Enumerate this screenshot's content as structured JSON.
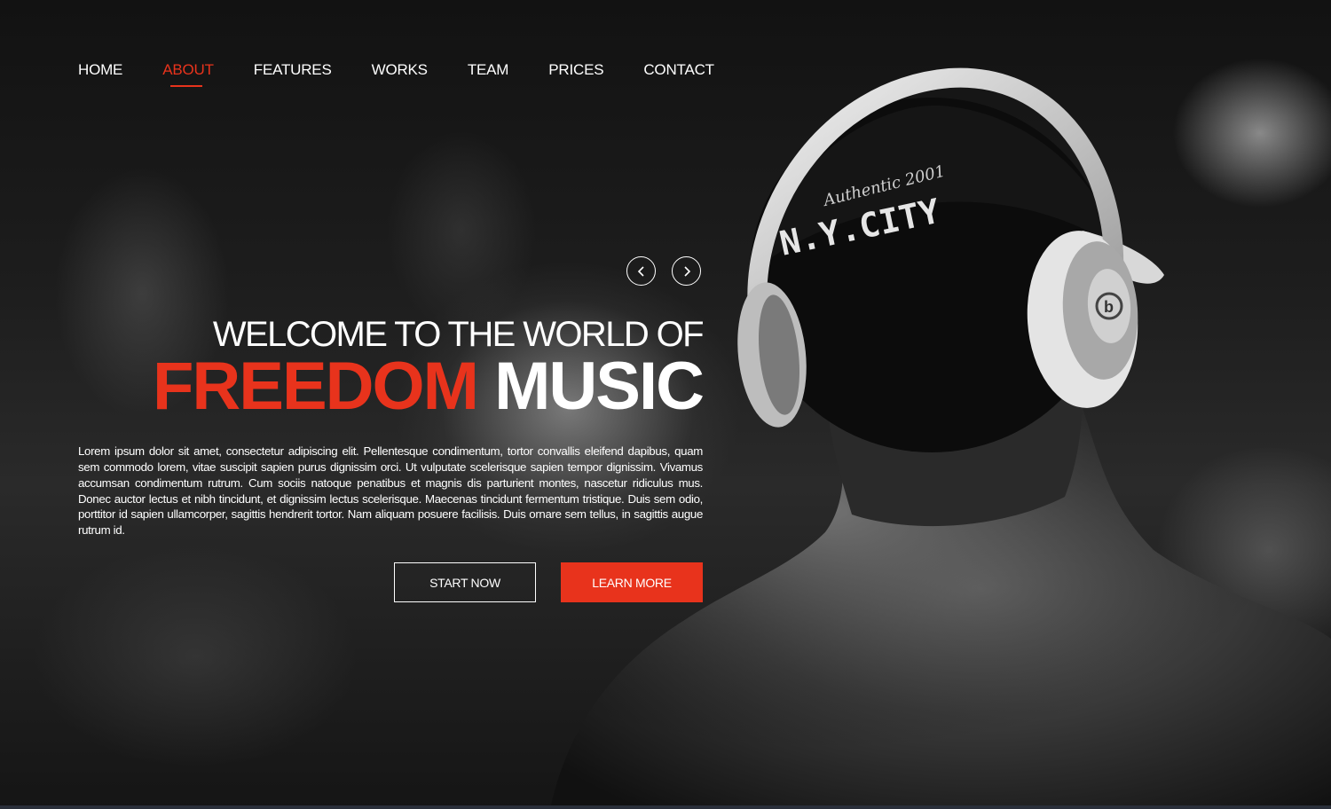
{
  "nav": {
    "items": [
      {
        "label": "HOME",
        "active": false
      },
      {
        "label": "ABOUT",
        "active": true
      },
      {
        "label": "FEATURES",
        "active": false
      },
      {
        "label": "WORKS",
        "active": false
      },
      {
        "label": "TEAM",
        "active": false
      },
      {
        "label": "PRICES",
        "active": false
      },
      {
        "label": "CONTACT",
        "active": false
      }
    ]
  },
  "slider": {
    "prev_icon": "chevron-left-icon",
    "next_icon": "chevron-right-icon"
  },
  "hero": {
    "subtitle": "WELCOME TO THE WORLD OF",
    "title_accent": "FREEDOM",
    "title_rest": "MUSIC",
    "body": "Lorem ipsum dolor sit amet, consectetur adipiscing elit. Pellentesque condimentum, tortor convallis eleifend dapibus, quam sem commodo lorem, vitae suscipit sapien purus dignissim orci. Ut vulputate scelerisque sapien tempor dignissim. Vivamus accumsan condimentum rutrum. Cum sociis natoque penatibus et magnis dis parturient montes, nascetur ridiculus mus. Donec auctor lectus et nibh tincidunt, et dignissim lectus scelerisque. Maecenas tincidunt fermentum tristique. Duis sem odio, porttitor id sapien ullamcorper, sagittis hendrerit tortor. Nam aliquam posuere facilisis. Duis ornare sem tellus, in sagittis augue rutrum id."
  },
  "buttons": {
    "start_label": "START NOW",
    "learn_label": "LEARN MORE"
  },
  "photo": {
    "cap_text": "N.Y.CITY",
    "cap_script": "Authentic 2001",
    "headphone_logo": "b"
  },
  "colors": {
    "accent": "#e8331c",
    "text": "#ffffff",
    "background": "#0a0a0a"
  }
}
